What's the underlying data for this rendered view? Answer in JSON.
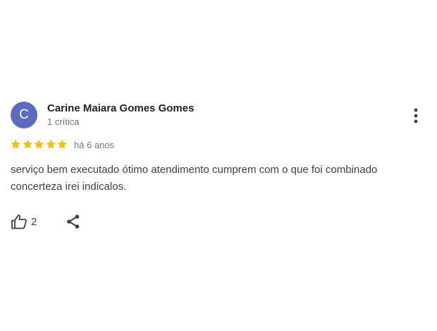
{
  "review": {
    "avatar_letter": "C",
    "avatar_color": "#5c6bc0",
    "author_name": "Carine Maiara Gomes Gomes",
    "author_meta": "1 crítica",
    "rating": 5,
    "rating_max": 5,
    "star_color": "#fbbc04",
    "date": "há 6 anos",
    "text": "serviço bem executado ótimo atendimento cumprem com o que foi combinado concerteza irei indicalos.",
    "likes": "2"
  },
  "icons": {
    "more": "more-vert-icon",
    "star": "star-icon",
    "like": "thumb-up-icon",
    "share": "share-icon"
  }
}
